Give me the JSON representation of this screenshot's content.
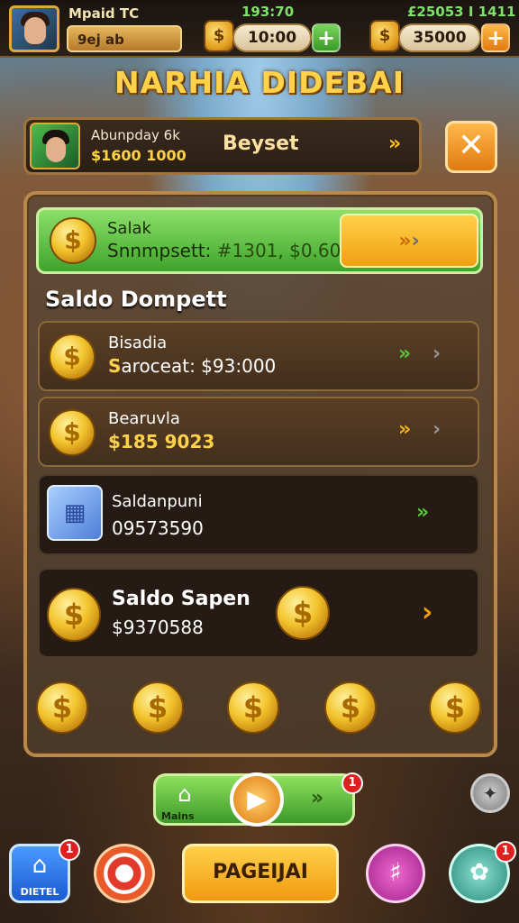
{
  "topbar": {
    "player_name": "Mpaid ТС",
    "player_sub": "9ej ab",
    "center_stat": "193:70",
    "center_value": "10:00",
    "right_stat": "£25053 I 1411",
    "right_value": "35000"
  },
  "title": "NARHIA DIDEBAI",
  "profile": {
    "line1": "Abunpday 6k",
    "line2": "$1600 1000",
    "action": "Beyset"
  },
  "wallet_header": {
    "line1": "Salak",
    "line2_a": "Snnmpsett:",
    "line2_b": "#1301, $0.60"
  },
  "section_title": "Saldo Dompett",
  "rows": [
    {
      "title": "Bisadia",
      "sub_prefix": "S",
      "sub_rest": "aroceat:  $93:000",
      "icon": "coin-icon"
    },
    {
      "title": "Bearuvla",
      "sub_prefix": "$185 9023",
      "sub_rest": "",
      "icon": "coin-icon"
    },
    {
      "title": "Saldanpuni",
      "sub_prefix": "",
      "sub_rest": "09573590",
      "icon": "box-icon"
    },
    {
      "title": "Saldo Sapen",
      "sub_prefix": "",
      "sub_rest": "$9370588",
      "icon": "coin-icon"
    }
  ],
  "bottom_nav": {
    "play_label": "Mains",
    "center_button": "PAGEIJAI",
    "notification_count": "1",
    "home_label": "DIETEL"
  },
  "colors": {
    "gold": "#ffd24a",
    "green": "#4fb83a",
    "wood": "#5a3e24"
  }
}
